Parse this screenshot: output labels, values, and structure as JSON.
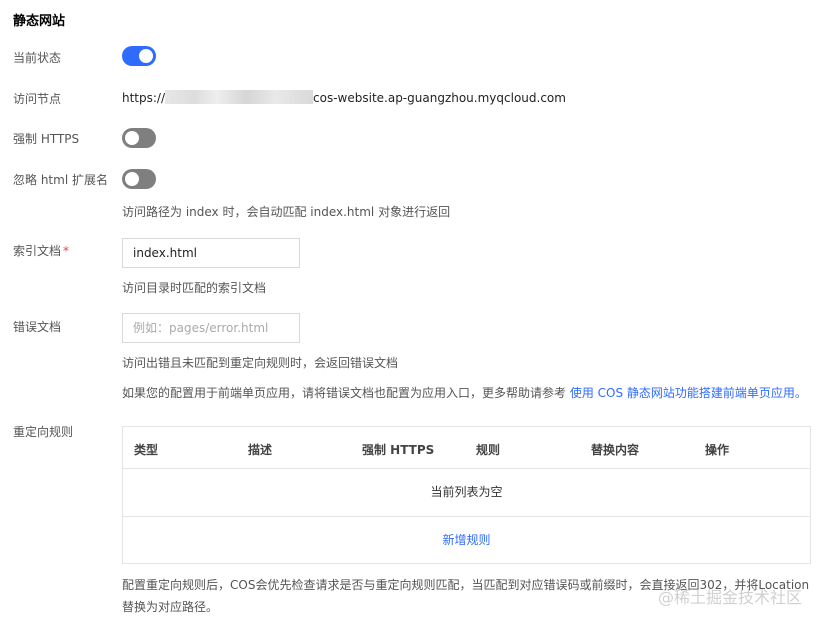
{
  "section_title": "静态网站",
  "status": {
    "label": "当前状态",
    "enabled": true
  },
  "endpoint": {
    "label": "访问节点",
    "prefix": "https://",
    "suffix": "cos-website.ap-guangzhou.myqcloud.com"
  },
  "force_https": {
    "label": "强制 HTTPS",
    "enabled": false
  },
  "ignore_html": {
    "label": "忽略 html 扩展名",
    "enabled": false,
    "hint": "访问路径为 index 时，会自动匹配 index.html 对象进行返回"
  },
  "index_doc": {
    "label": "索引文档",
    "required_mark": "*",
    "value": "index.html",
    "hint": "访问目录时匹配的索引文档"
  },
  "error_doc": {
    "label": "错误文档",
    "placeholder": "例如：pages/error.html",
    "hint": "访问出错且未匹配到重定向规则时，会返回错误文档",
    "help_text": "如果您的配置用于前端单页应用，请将错误文档也配置为应用入口，更多帮助请参考",
    "help_link": "使用 COS 静态网站功能搭建前端单页应用。"
  },
  "redirect_rules": {
    "label": "重定向规则",
    "columns": [
      "类型",
      "描述",
      "强制 HTTPS",
      "规则",
      "替换内容",
      "操作"
    ],
    "empty_text": "当前列表为空",
    "add_link": "新增规则",
    "note_line1": "配置重定向规则后，COS会优先检查请求是否与重定向规则匹配，当匹配到对应错误码或前缀时，会直接返回302，并将Location",
    "note_line2": "替换为对应路径。"
  },
  "watermark": "@稀土掘金技术社区",
  "colors": {
    "accent": "#2f6bff",
    "toggle_off": "#7f7f7f",
    "required": "#e54545"
  }
}
